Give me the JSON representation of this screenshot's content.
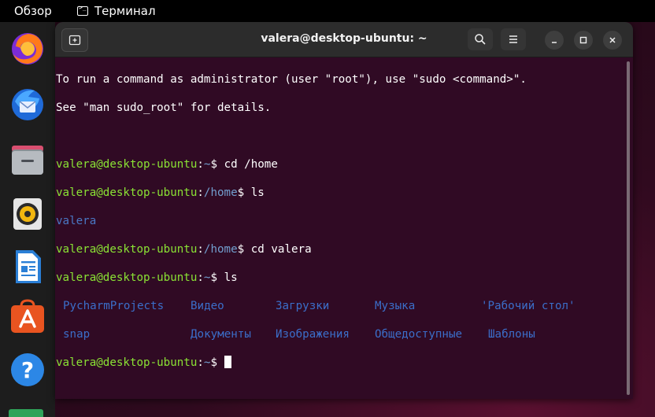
{
  "topbar": {
    "activities": "Обзор",
    "app_name": "Терминал"
  },
  "dock": {
    "items": [
      {
        "icon": "firefox-icon"
      },
      {
        "icon": "thunderbird-icon"
      },
      {
        "icon": "files-icon"
      },
      {
        "icon": "rhythmbox-icon"
      },
      {
        "icon": "libreoffice-writer-icon"
      },
      {
        "icon": "app-center-icon"
      },
      {
        "icon": "help-icon"
      }
    ]
  },
  "window": {
    "title": "valera@desktop-ubuntu: ~"
  },
  "terminal": {
    "motd1": "To run a command as administrator (user \"root\"), use \"sudo <command>\".",
    "motd2": "See \"man sudo_root\" for details.",
    "user_host": "valera@desktop-ubuntu",
    "cmd1_path": "~",
    "cmd1": "cd /home",
    "cmd2_path": "/home",
    "cmd2": "ls",
    "out2": "valera",
    "cmd3_path": "/home",
    "cmd3": "cd valera",
    "cmd4_path": "~",
    "cmd4": "ls",
    "ls_row1": [
      "PycharmProjects",
      "Видео",
      "Загрузки",
      "Музыка",
      "'Рабочий стол'"
    ],
    "ls_row2": [
      "snap",
      "Документы",
      "Изображения",
      "Общедоступные",
      "Шаблоны"
    ],
    "prompt_path": "~"
  }
}
